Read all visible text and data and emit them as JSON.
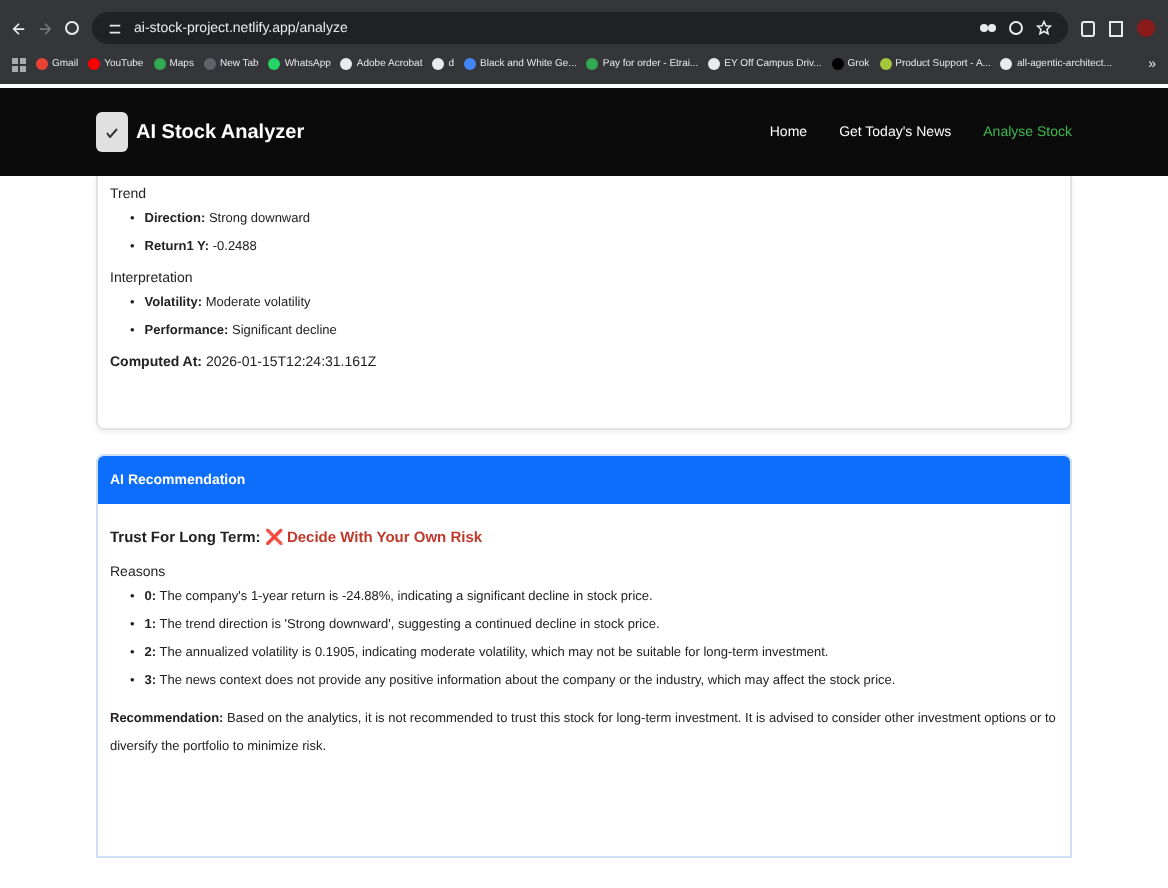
{
  "browser": {
    "url": "ai-stock-project.netlify.app/analyze",
    "bookmarks": [
      {
        "label": "Gmail",
        "color": "#ea4335"
      },
      {
        "label": "YouTube",
        "color": "#ff0000"
      },
      {
        "label": "Maps",
        "color": "#34a853"
      },
      {
        "label": "New Tab",
        "color": "#5f6368"
      },
      {
        "label": "WhatsApp",
        "color": "#25d366"
      },
      {
        "label": "Adobe Acrobat",
        "color": "#e8eaed"
      },
      {
        "label": "d",
        "color": "#e8eaed"
      },
      {
        "label": "Black and White Ge...",
        "color": "#4285f4"
      },
      {
        "label": "Pay for order - Etrai...",
        "color": "#34a853"
      },
      {
        "label": "EY Off Campus Driv...",
        "color": "#e8eaed"
      },
      {
        "label": "Grok",
        "color": "#000000"
      },
      {
        "label": "Product Support - A...",
        "color": "#a4c639"
      },
      {
        "label": "all-agentic-architect...",
        "color": "#e8eaed"
      }
    ],
    "more": "»"
  },
  "navbar": {
    "brand": "AI Stock Analyzer",
    "links": [
      {
        "label": "Home",
        "selected": false
      },
      {
        "label": "Get Today's News",
        "selected": false
      },
      {
        "label": "Analyse Stock",
        "selected": true
      }
    ]
  },
  "analysis": {
    "bullet": "•",
    "sections": [
      {
        "title": "Trend",
        "items": [
          {
            "key": "Direction:",
            "value": "Strong downward"
          },
          {
            "key": "Return1 Y:",
            "value": "-0.2488"
          }
        ]
      },
      {
        "title": "Interpretation",
        "items": [
          {
            "key": "Volatility:",
            "value": "Moderate volatility"
          },
          {
            "key": "Performance:",
            "value": "Significant decline"
          }
        ]
      }
    ],
    "computed": {
      "key": "Computed At:",
      "value": "2026-01-15T12:24:31.161Z"
    }
  },
  "recommendation": {
    "header": "AI Recommendation",
    "trust_label": "Trust For Long Term:",
    "trust_icon": "❌",
    "trust_value": "Decide With Your Own Risk",
    "reasons_title": "Reasons",
    "bullet": "•",
    "reasons": [
      {
        "key": "0:",
        "text": "The company's 1-year return is -24.88%, indicating a significant decline in stock price."
      },
      {
        "key": "1:",
        "text": "The trend direction is 'Strong downward', suggesting a continued decline in stock price."
      },
      {
        "key": "2:",
        "text": "The annualized volatility is 0.1905, indicating moderate volatility, which may not be suitable for long-term investment."
      },
      {
        "key": "3:",
        "text": "The news context does not provide any positive information about the company or the industry, which may affect the stock price."
      }
    ],
    "summary_key": "Recommendation:",
    "summary": "Based on the analytics, it is not recommended to trust this stock for long-term investment. It is advised to consider other investment options or to diversify the portfolio to minimize risk."
  }
}
